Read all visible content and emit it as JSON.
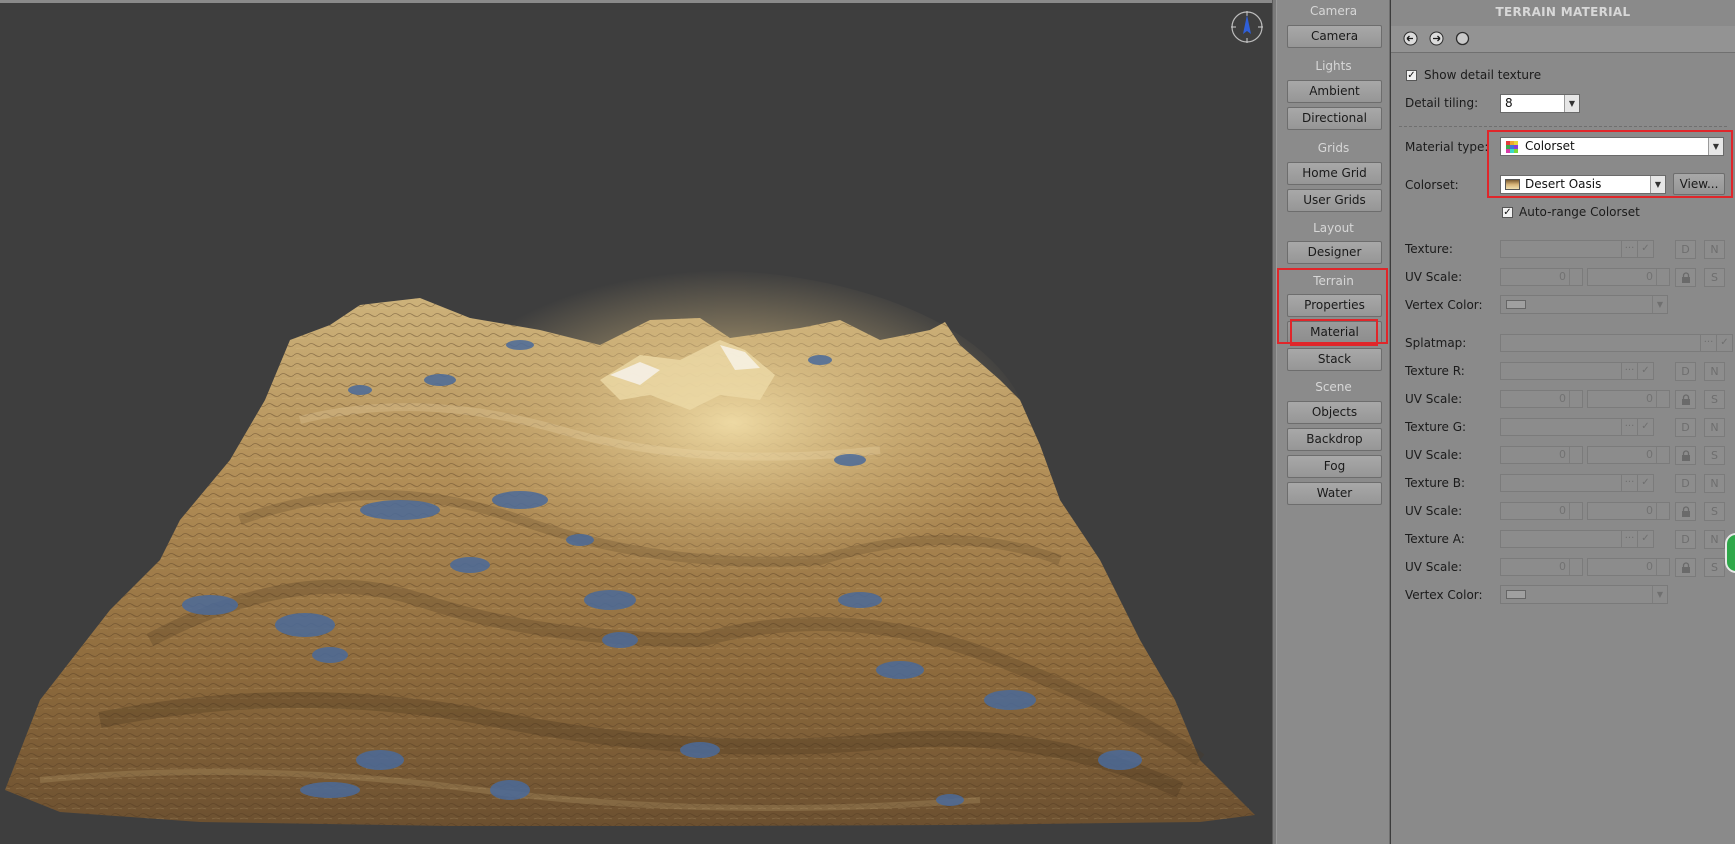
{
  "nav": {
    "groups": {
      "camera": "Camera",
      "lights": "Lights",
      "grids": "Grids",
      "layout": "Layout",
      "terrain": "Terrain",
      "scene": "Scene"
    },
    "buttons": {
      "camera": "Camera",
      "ambient": "Ambient",
      "directional": "Directional",
      "home_grid": "Home Grid",
      "user_grids": "User Grids",
      "designer": "Designer",
      "properties": "Properties",
      "material": "Material",
      "stack": "Stack",
      "objects": "Objects",
      "backdrop": "Backdrop",
      "fog": "Fog",
      "water": "Water"
    },
    "active": "Material"
  },
  "panel": {
    "title": "TERRAIN MATERIAL",
    "toolbar_icons": [
      "import-icon",
      "export-icon",
      "preview-sphere-icon"
    ],
    "show_detail_texture": {
      "label": "Show detail texture",
      "checked": true
    },
    "detail_tiling": {
      "label": "Detail tiling:",
      "value": "8"
    },
    "material_type": {
      "label": "Material type:",
      "value": "Colorset"
    },
    "colorset": {
      "label": "Colorset:",
      "value": "Desert Oasis",
      "view_button": "View..."
    },
    "auto_range": {
      "label": "Auto-range Colorset",
      "checked": true
    },
    "texture": {
      "label": "Texture:"
    },
    "uv_scale_label": "UV Scale:",
    "uv_value": "0",
    "vertex_color_label": "Vertex Color:",
    "splatmap_label": "Splatmap:",
    "texture_r": "Texture R:",
    "texture_g": "Texture G:",
    "texture_b": "Texture B:",
    "texture_a": "Texture A:",
    "btn_d": "D",
    "btn_n": "N",
    "btn_s": "S",
    "dots": "···",
    "check": "✓"
  },
  "colors": {
    "highlight": "#e0262a",
    "viewport_bg": "#3e3e3e",
    "panel_bg": "#8a8a8a",
    "terrain_light": "#d9c08a",
    "terrain_mid": "#a8834f",
    "terrain_dark": "#5a4226",
    "water": "#4a6a9a"
  }
}
